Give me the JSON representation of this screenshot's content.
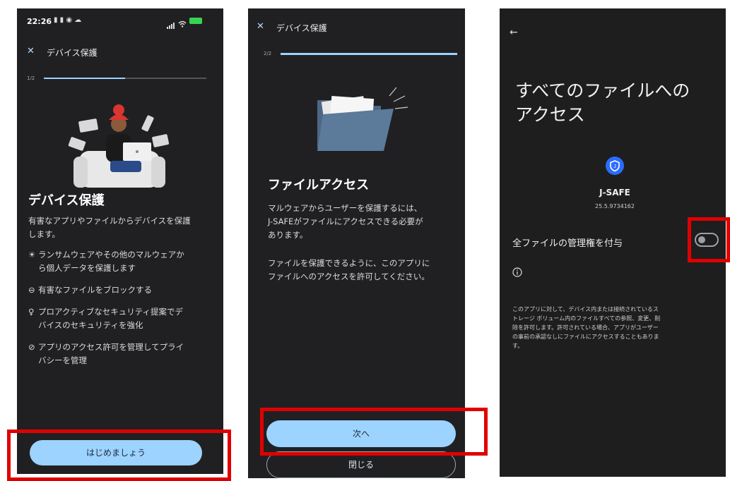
{
  "screen1": {
    "status_time": "22:26",
    "close_glyph": "✕",
    "title": "デバイス保護",
    "step": "1/2",
    "heading": "デバイス保護",
    "intro": [
      "有害なアプリやファイルからデバイスを保護",
      "します。"
    ],
    "features": [
      {
        "icon": "bug-icon",
        "lines": [
          "ランサムウェアやその他のマルウェアか",
          "ら個人データを保護します"
        ]
      },
      {
        "icon": "block-icon",
        "lines": [
          "有害なファイルをブロックする"
        ]
      },
      {
        "icon": "lightbulb-icon",
        "lines": [
          "プロアクティブなセキュリティ提案でデ",
          "バイスのセキュリティを強化"
        ]
      },
      {
        "icon": "privacy-icon",
        "lines": [
          "アプリのアクセス許可を管理してプライ",
          "バシーを管理"
        ]
      }
    ],
    "start_button": "はじめましょう"
  },
  "screen2": {
    "close_glyph": "✕",
    "title": "デバイス保護",
    "step": "2/2",
    "heading": "ファイルアクセス",
    "paragraph1": [
      "マルウェアからユーザーを保護するには、",
      "J-SAFEがファイルにアクセスできる必要が",
      "あります。"
    ],
    "paragraph2": [
      "ファイルを保護できるように、このアプリに",
      "ファイルへのアクセスを許可してください。"
    ],
    "next_button": "次へ",
    "close_button": "閉じる"
  },
  "screen3": {
    "back_glyph": "←",
    "heading": [
      "すべてのファイルへの",
      "アクセス"
    ],
    "app_name": "J-SAFE",
    "app_version": "25.5.9734162",
    "toggle_label": "全ファイルの管理権を付与",
    "toggle_on": false,
    "info_text": [
      "このアプリに対して、デバイス内または接続されているス",
      "トレージ ボリューム内のファイルすべての参照、変更、削",
      "除を許可します。許可されている場合、アプリがユーザー",
      "の事前の承認なしにファイルにアクセスすることもありま",
      "す。"
    ]
  },
  "colors": {
    "accent": "#9dd3ff",
    "highlight": "#e00000",
    "background": "#202023",
    "shield": "#2b6cff"
  }
}
